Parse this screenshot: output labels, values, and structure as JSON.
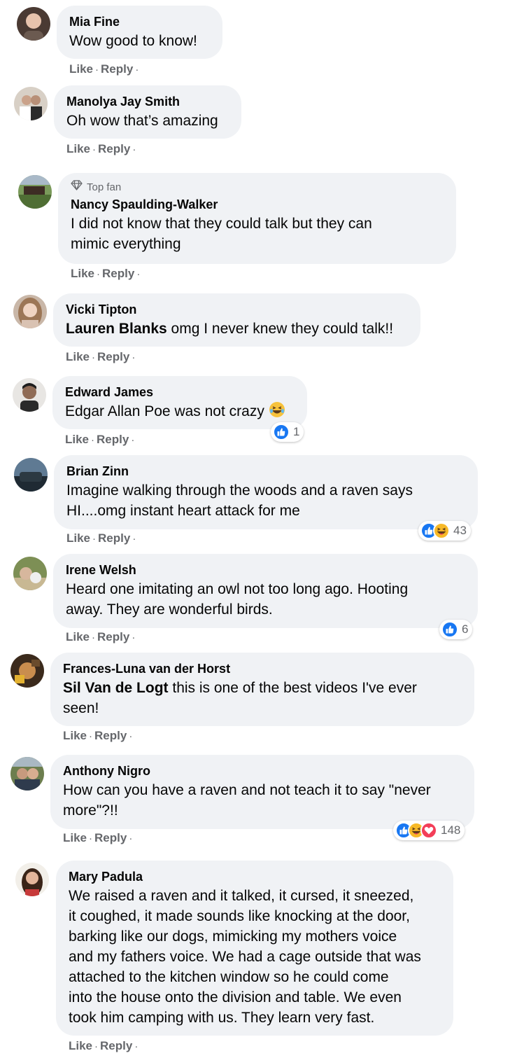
{
  "actions": {
    "like": "Like",
    "reply": "Reply",
    "dot": "·"
  },
  "colors": {
    "bubble": "#f0f2f5",
    "meta": "#65676b",
    "like_blue": "#1877f2",
    "haha_yellow": "#f7b928",
    "love_red": "#f33e58"
  },
  "comments": [
    {
      "name": "Mia Fine",
      "text": "Wow good to know!"
    },
    {
      "name": "Manolya Jay Smith",
      "text": "Oh wow that’s amazing"
    },
    {
      "badge": "Top fan",
      "badge_icon": "diamond-icon",
      "name": "Nancy Spaulding-Walker",
      "text_lines": [
        "I did not know that they could talk but they can",
        "mimic everything"
      ]
    },
    {
      "name": "Vicki Tipton",
      "mention": "Lauren Blanks",
      "text": " omg I never knew they could talk!!"
    },
    {
      "name": "Edward James",
      "text": "Edgar Allan Poe was not crazy ",
      "emoji": "laughing-emoji",
      "reactions": [
        "like-reaction"
      ],
      "reaction_count": "1"
    },
    {
      "name": "Brian Zinn",
      "text_lines": [
        "Imagine walking through the woods and a raven says",
        "HI....omg instant heart attack for me"
      ],
      "reactions": [
        "like-reaction",
        "haha-reaction"
      ],
      "reaction_count": "43"
    },
    {
      "name": "Irene Welsh",
      "text_lines": [
        "Heard one imitating an owl not too long ago. Hooting",
        "away. They are wonderful birds."
      ],
      "reactions": [
        "like-reaction"
      ],
      "reaction_count": "6"
    },
    {
      "name": "Frances-Luna van der Horst",
      "mention": "Sil Van de Logt",
      "text_lines": [
        " this is one of the best videos I've ever",
        "seen!"
      ]
    },
    {
      "name": "Anthony Nigro",
      "text_lines": [
        "How can you have a raven and not teach it to say \"never",
        "more\"?!!"
      ],
      "reactions": [
        "like-reaction",
        "haha-reaction",
        "love-reaction"
      ],
      "reaction_count": "148"
    },
    {
      "name": "Mary Padula",
      "text_lines": [
        "We raised a raven and it talked, it cursed, it sneezed,",
        "it coughed, it made sounds like knocking at the door,",
        "barking like our dogs, mimicking my mothers voice",
        "and my fathers voice. We had a cage outside that was",
        "attached to the kitchen window so he could come",
        "into the house onto the division and table. We even",
        "took him camping with us. They learn very fast."
      ]
    }
  ]
}
